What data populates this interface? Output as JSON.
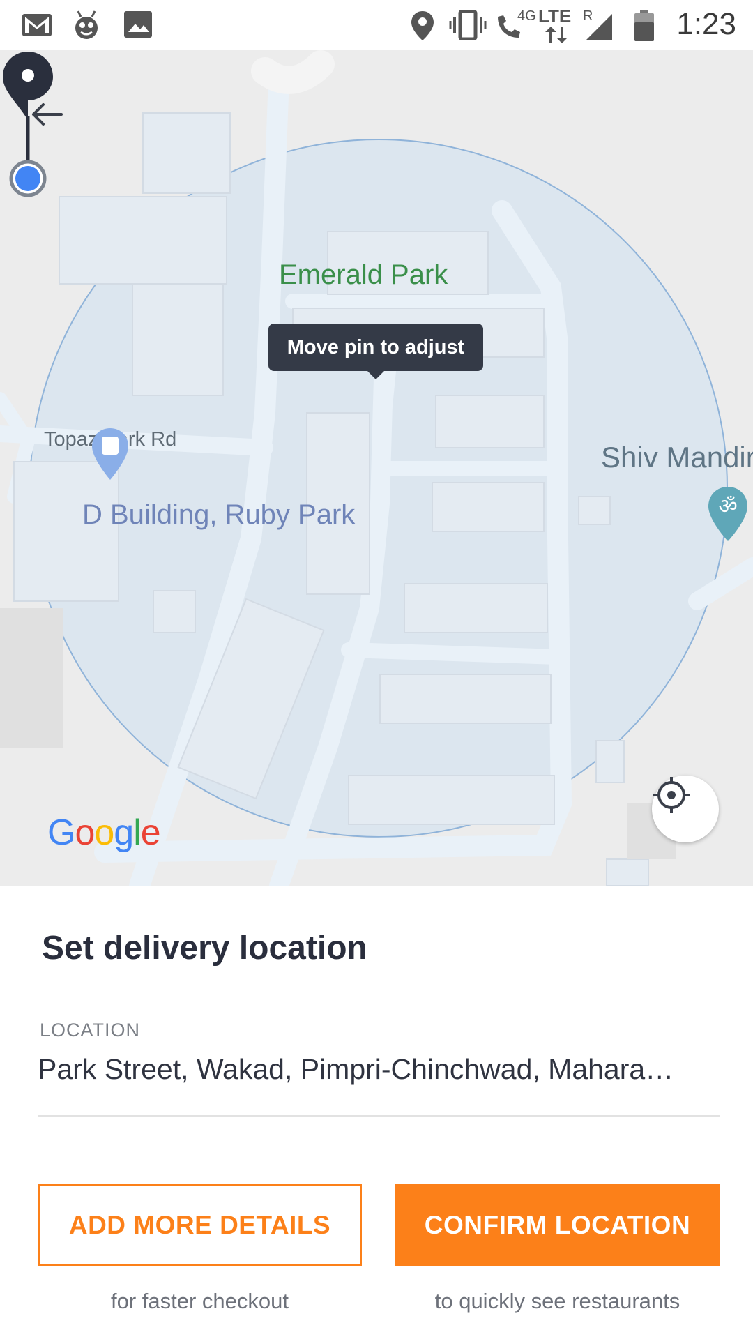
{
  "status_bar": {
    "time": "1:23",
    "network_label": "4G",
    "lte_label": "LTE",
    "roaming_label": "R",
    "icons": [
      "gmail-icon",
      "bug-mascot-icon",
      "image-icon",
      "location-icon",
      "vibrate-icon",
      "wifi-call-icon",
      "lte-icon",
      "signal-icon",
      "battery-icon"
    ]
  },
  "map": {
    "tooltip": "Move pin to adjust",
    "labels": {
      "emerald_park": "Emerald Park",
      "topaz_park_rd": "Topaz Park Rd",
      "d_building": "D Building, Ruby Park",
      "shiv_mandir": "Shiv Mandir"
    },
    "attribution": "Google",
    "colors": {
      "accuracy_circle": "#dde7f0",
      "pin": "#2a2f3d",
      "location_dot": "#4285f4"
    }
  },
  "sheet": {
    "title": "Set delivery location",
    "location_caption": "LOCATION",
    "location_value": "Park Street, Wakad, Pimpri-Chinchwad, Mahara…",
    "add_details_label": "ADD MORE DETAILS",
    "add_details_sub": "for faster checkout",
    "confirm_label": "CONFIRM LOCATION",
    "confirm_sub": "to quickly see restaurants",
    "accent_color": "#fc8019"
  }
}
